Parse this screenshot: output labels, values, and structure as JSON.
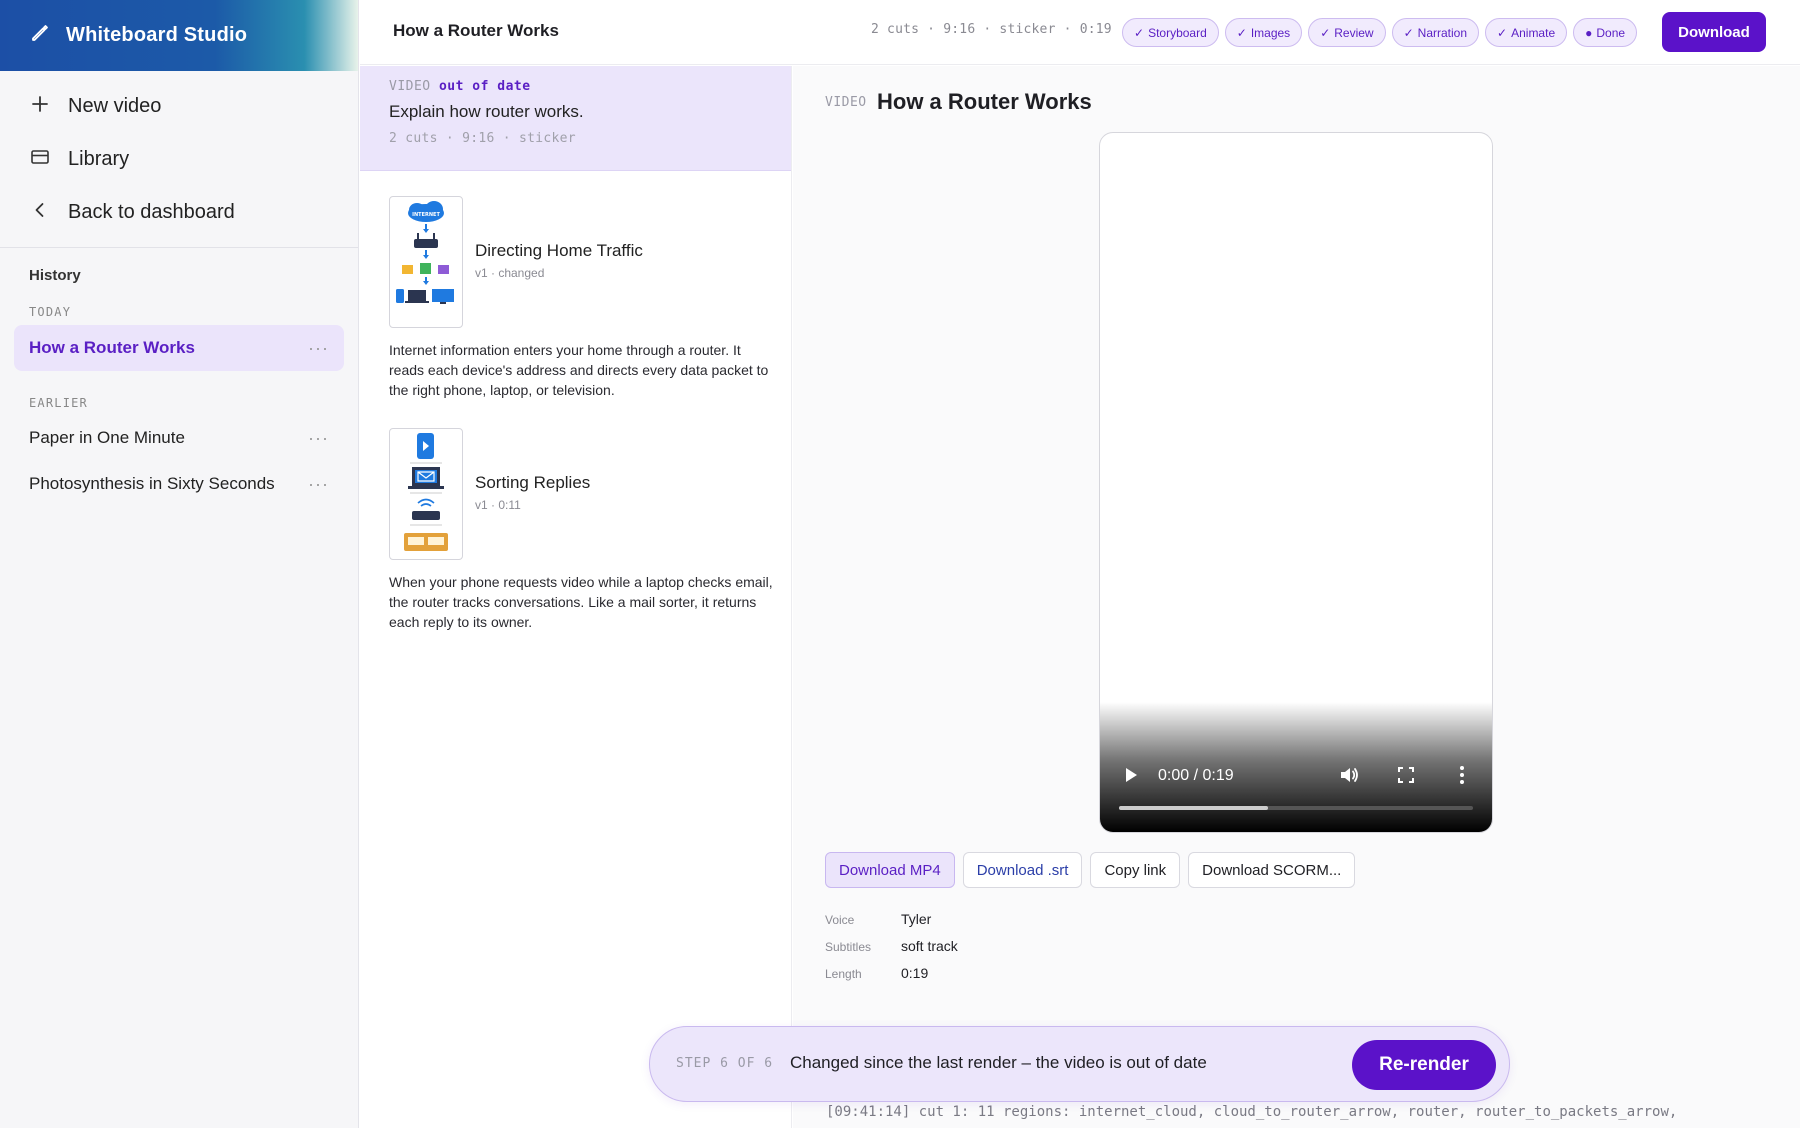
{
  "app": {
    "title": "Whiteboard Studio"
  },
  "nav": {
    "new_video": "New video",
    "library": "Library",
    "back": "Back to dashboard"
  },
  "history": {
    "label": "History",
    "today_label": "TODAY",
    "earlier_label": "EARLIER",
    "today": [
      {
        "title": "How a Router Works"
      }
    ],
    "earlier": [
      {
        "title": "Paper in One Minute"
      },
      {
        "title": "Photosynthesis in Sixty Seconds"
      }
    ],
    "more": "···"
  },
  "topbar": {
    "title": "How a Router Works",
    "meta": "2 cuts · 9:16 · sticker · 0:19",
    "steps": [
      {
        "label": "Storyboard",
        "mark": "✓"
      },
      {
        "label": "Images",
        "mark": "✓"
      },
      {
        "label": "Review",
        "mark": "✓"
      },
      {
        "label": "Narration",
        "mark": "✓"
      },
      {
        "label": "Animate",
        "mark": "✓"
      },
      {
        "label": "Done",
        "mark": "●"
      }
    ],
    "download": "Download"
  },
  "prompt": {
    "label": "VIDEO",
    "status": "out of date",
    "text": "Explain how router works.",
    "meta": "2 cuts · 9:16 · sticker"
  },
  "cuts": [
    {
      "title": "Directing Home Traffic",
      "sub": "v1 · changed",
      "body": "Internet information enters your home through a router. It reads each device's address and directs every data packet to the right phone, laptop, or television.",
      "thumb_text": "INTERNET"
    },
    {
      "title": "Sorting Replies",
      "sub": "v1 · 0:11",
      "body": "When your phone requests video while a laptop checks email, the router tracks conversations. Like a mail sorter, it returns each reply to its owner."
    }
  ],
  "video": {
    "label": "VIDEO",
    "title": "How a Router Works",
    "time": "0:00 / 0:19",
    "progress_fraction": 0.42
  },
  "downloads": {
    "mp4": "Download MP4",
    "srt": "Download .srt",
    "copy": "Copy link",
    "scorm": "Download SCORM..."
  },
  "info": {
    "voice_key": "Voice",
    "voice_val": "Tyler",
    "subtitles_key": "Subtitles",
    "subtitles_val": "soft track",
    "length_key": "Length",
    "length_val": "0:19"
  },
  "toast": {
    "step": "STEP 6 OF 6",
    "message": "Changed since the last render – the video is out of date",
    "button": "Re-render"
  },
  "log": "[09:41:14] cut 1: 11 regions: internet_cloud, cloud_to_router_arrow, router, router_to_packets_arrow,",
  "colors": {
    "accent": "#5b12c9",
    "accent_soft": "#ebe4fb",
    "brand_blue": "#1c4fa6"
  }
}
